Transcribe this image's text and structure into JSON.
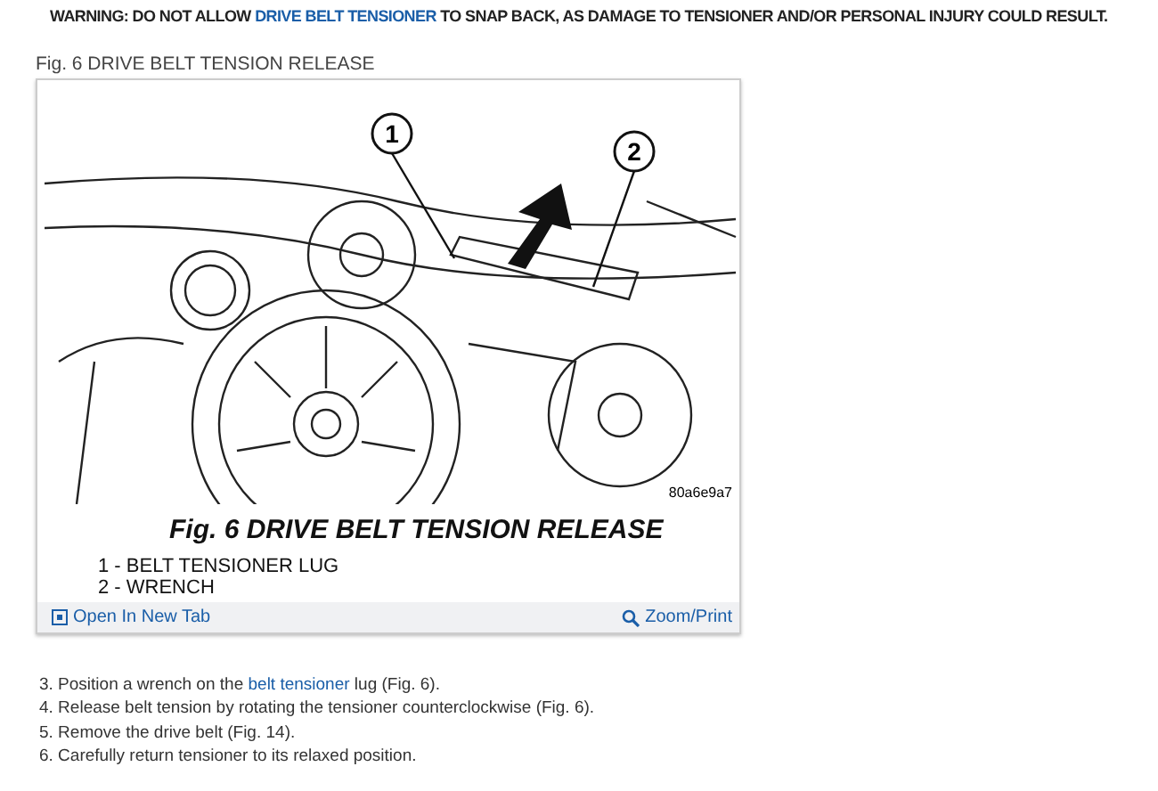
{
  "warning": [
    {
      "text": "WARNING: DO NOT ALLOW ",
      "link": false
    },
    {
      "text": "DRIVE BELT TENSIONER",
      "link": true
    },
    {
      "text": " TO SNAP BACK, AS DAMAGE TO TENSIONER AND/OR PERSONAL INJURY COULD RESULT.",
      "link": false
    }
  ],
  "figure": {
    "heading": "Fig. 6 DRIVE BELT TENSION RELEASE",
    "callouts": [
      "1",
      "2"
    ],
    "image_id": "80a6e9a7",
    "caption": "Fig. 6 DRIVE BELT TENSION RELEASE",
    "legend": [
      "1 - BELT TENSIONER LUG",
      "2 - WRENCH"
    ],
    "open_link": "Open In New Tab",
    "zoom_link": "Zoom/Print"
  },
  "steps": [
    {
      "parts": [
        {
          "text": "3. Position a wrench on the ",
          "link": false
        },
        {
          "text": "belt tensioner",
          "link": true
        },
        {
          "text": " lug (Fig. 6).",
          "link": false
        }
      ]
    },
    {
      "parts": [
        {
          "text": "4. Release belt tension by rotating the tensioner counterclockwise (Fig. 6).",
          "link": false
        }
      ]
    },
    {
      "parts": [
        {
          "text": "5. Remove the drive belt (Fig. 14).",
          "link": false
        }
      ]
    },
    {
      "parts": [
        {
          "text": "6. Carefully return tensioner to its relaxed position.",
          "link": false
        }
      ]
    }
  ]
}
